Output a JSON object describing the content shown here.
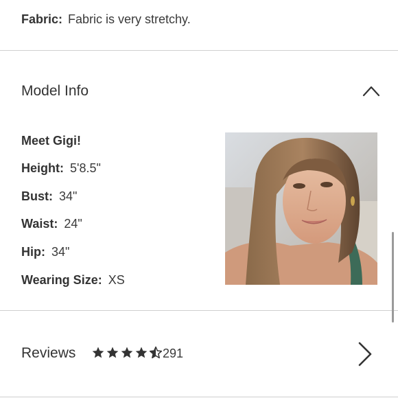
{
  "fabric": {
    "label": "Fabric:",
    "value": "Fabric is very stretchy."
  },
  "model_info": {
    "title": "Model Info",
    "intro": "Meet Gigi!",
    "details": [
      {
        "label": "Height:",
        "value": "5'8.5\""
      },
      {
        "label": "Bust:",
        "value": "34\""
      },
      {
        "label": "Waist:",
        "value": "24\""
      },
      {
        "label": "Hip:",
        "value": "34\""
      },
      {
        "label": "Wearing Size:",
        "value": "XS"
      }
    ]
  },
  "reviews": {
    "title": "Reviews",
    "rating": 4.5,
    "rating_max": 5,
    "count": "291"
  },
  "icons": {
    "collapse": "chevron-up-icon",
    "expand": "chevron-right-icon",
    "rating": "star-icon"
  },
  "colors": {
    "text": "#333333",
    "divider": "#cfcfcf",
    "background": "#ffffff"
  }
}
